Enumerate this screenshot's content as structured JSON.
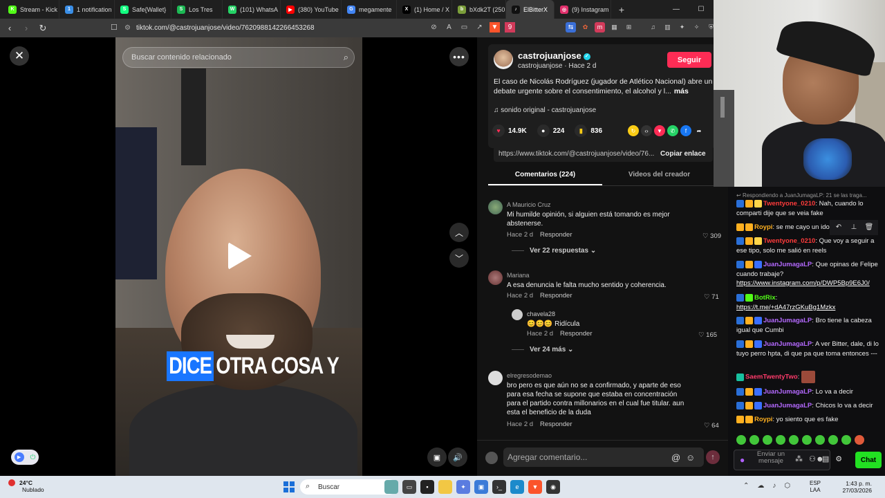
{
  "browser": {
    "tabs": [
      {
        "label": "Stream - Kick",
        "color": "#53fc18",
        "glyph": "K"
      },
      {
        "label": "1 notification",
        "color": "#3a8ee6",
        "glyph": "1"
      },
      {
        "label": "Safe{Wallet}",
        "color": "#12ff80",
        "glyph": "S"
      },
      {
        "label": "Los Tres",
        "color": "#1db954",
        "glyph": "S"
      },
      {
        "label": "(101) WhatsA",
        "color": "#25d366",
        "glyph": "W"
      },
      {
        "label": "(380) YouTube",
        "color": "#ff0000",
        "glyph": "▶"
      },
      {
        "label": "megamente",
        "color": "#4285f4",
        "glyph": "G"
      },
      {
        "label": "(1) Home / X",
        "color": "#000000",
        "glyph": "X"
      },
      {
        "label": "bXdk2T (250",
        "color": "#7b9e3a",
        "glyph": "b"
      },
      {
        "label": "ElBitterX",
        "color": "#111111",
        "glyph": "♪"
      },
      {
        "label": "(9) Instagram",
        "color": "#e1306c",
        "glyph": "◎"
      }
    ],
    "active_tab": "ElBitterX",
    "new_tab_glyph": "+",
    "url": "tiktok.com/@castrojuanjose/video/7620988142266453268",
    "extension_badge": "9"
  },
  "video": {
    "search_placeholder": "Buscar contenido relacionado",
    "caption_highlight": "DICE",
    "caption_rest": "OTRA COSA Y"
  },
  "author": {
    "name": "castrojuanjose",
    "subline": "castrojuanjose · Hace 2 d",
    "follow_label": "Seguir",
    "description": "El caso de Nicolás Rodríguez (jugador de Atlético Nacional) abre un debate urgente sobre el consentimiento, el alcohol y l...",
    "more_label": "más",
    "sound": "sonido original - castrojuanjose",
    "likes": "14.9K",
    "comments_count": "224",
    "saves": "836",
    "share_url": "https://www.tiktok.com/@castrojuanjose/video/76...",
    "copy_label": "Copiar enlace"
  },
  "panel_tabs": {
    "comments": "Comentarios (224)",
    "creator_videos": "Videos del creador"
  },
  "comments": [
    {
      "name": "A Mauricio Cruz",
      "text": "Mi humilde opinión, si alguien está tomando es mejor abstenerse.",
      "time": "Hace 2 d",
      "reply": "Responder",
      "likes": "309",
      "replies": "Ver 22 respuestas"
    },
    {
      "name": "Mariana",
      "text": "A esa denuncia le falta mucho sentido y coherencia.",
      "time": "Hace 2 d",
      "reply": "Responder",
      "likes": "71"
    },
    {
      "name": "chavela28",
      "text": "😊😊😊 Ridícula",
      "time": "Hace 2 d",
      "reply": "Responder",
      "likes": "165",
      "replies": "Ver 24 más"
    },
    {
      "name": "elregresodemao",
      "text": "bro pero es que aún no se a confirmado, y aparte de eso para esa fecha se supone que estaba en concentración para el partido contra millonarios en el cual fue titular. aun esta el beneficio de la duda",
      "time": "Hace 2 d",
      "reply": "Responder",
      "likes": "64"
    }
  ],
  "add_comment_placeholder": "Agregar comentario...",
  "chat": {
    "reply_context": "Respondiendo a JuanJumagaLP: 21 se las traga...",
    "messages": [
      {
        "user": "Twentyone_0210",
        "color": "#ff3b3b",
        "text": "Nah, cuando lo comparti dije que se veia fake"
      },
      {
        "user": "Roypi",
        "color": "#ffb020",
        "text": "se me cayo un idolo"
      },
      {
        "user": "Twentyone_0210",
        "color": "#ff3b3b",
        "text": "Que voy a seguir a ese tipo, solo me salió en reels"
      },
      {
        "user": "JuanJumagaLP",
        "color": "#b469ff",
        "text": "Que opinas de Felipe cuando trabaje?",
        "link": "https://www.instagram.com/p/DWP5Bp9E6J0/"
      },
      {
        "user": "BotRix",
        "color": "#53fc18",
        "text": "",
        "link": "https://t.me/+dA47rzGKuBg1Mzkx"
      },
      {
        "user": "JuanJumagaLP",
        "color": "#b469ff",
        "text": "Bro tiene la cabeza igual que Cumbi"
      },
      {
        "user": "JuanJumagaLP",
        "color": "#b469ff",
        "text": "A ver Bitter, dale, di lo tuyo perro hpta, di que pa que toma entonces ---"
      },
      {
        "user": "SaemTwentyTwo",
        "color": "#ff3b6b",
        "text": ""
      },
      {
        "user": "JuanJumagaLP",
        "color": "#b469ff",
        "text": "Lo va a decir"
      },
      {
        "user": "JuanJumagaLP",
        "color": "#b469ff",
        "text": "Chicos lo va a decir"
      },
      {
        "user": "Roypi",
        "color": "#ffb020",
        "text": "yo siento que es fake"
      }
    ],
    "input_placeholder": "Enviar un mensaje",
    "chat_button": "Chat"
  },
  "taskbar": {
    "temp": "24°C",
    "weather": "Nublado",
    "search_label": "Buscar",
    "lang_top": "ESP",
    "lang_bottom": "LAA",
    "time": "1:43 p. m.",
    "date": "27/03/2026"
  },
  "colors": {
    "tiktok_red": "#fe2c55",
    "kick_green": "#53fc18",
    "caption_blue": "#1976ff"
  }
}
